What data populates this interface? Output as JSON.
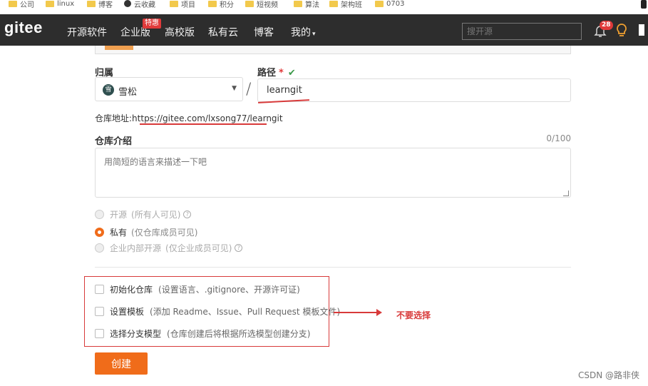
{
  "bookmarks": [
    {
      "label": "公司",
      "icon": "folder-icon"
    },
    {
      "label": "linux",
      "icon": "folder-icon"
    },
    {
      "label": "博客",
      "icon": "folder-icon"
    },
    {
      "label": "云收藏",
      "icon": "globe-icon"
    },
    {
      "label": "项目",
      "icon": "folder-icon"
    },
    {
      "label": "积分",
      "icon": "folder-icon"
    },
    {
      "label": "短视频",
      "icon": "folder-icon"
    },
    {
      "label": "算法",
      "icon": "folder-icon"
    },
    {
      "label": "架构班",
      "icon": "folder-icon"
    },
    {
      "label": "0703",
      "icon": "folder-icon"
    }
  ],
  "navbar": {
    "logo": "gitee",
    "items": [
      "开源软件",
      "企业版",
      "高校版",
      "私有云",
      "博客",
      "我的"
    ],
    "enterprise_badge": "特惠",
    "my_caret": "▾",
    "search_placeholder": "搜开源",
    "notification_count": "28"
  },
  "form": {
    "owner_label": "归属",
    "owner_avatar": "雪",
    "owner_value": "雪松",
    "slash": "/",
    "path_label": "路径",
    "path_required": "*",
    "path_valid": "✔",
    "path_value": "learngit",
    "address_label": "仓库地址:",
    "address_url": "https://gitee.com/lxsong77/learngit",
    "desc_label": "仓库介绍",
    "desc_counter": "0/100",
    "desc_placeholder": "用简短的语言来描述一下吧",
    "visibility": [
      {
        "label": "开源",
        "sub": "(所有人可见)",
        "help": "?",
        "state": "disabled",
        "checked": false
      },
      {
        "label": "私有",
        "sub": "(仅仓库成员可见)",
        "help": "",
        "state": "enabled",
        "checked": true
      },
      {
        "label": "企业内部开源",
        "sub": "(仅企业成员可见)",
        "help": "?",
        "state": "disabled",
        "checked": false
      }
    ],
    "options": [
      {
        "label": "初始化仓库",
        "sub": "(设置语言、.gitignore、开源许可证)",
        "checked": false
      },
      {
        "label": "设置模板",
        "sub": "(添加 Readme、Issue、Pull Request 模板文件)",
        "checked": false
      },
      {
        "label": "选择分支模型",
        "sub": "(仓库创建后将根据所选模型创建分支)",
        "checked": false
      }
    ],
    "annotation": "不要选择",
    "create_label": "创建"
  },
  "watermark": "CSDN @路非侠",
  "colors": {
    "accent": "#f06c1a",
    "navbar": "#2d2d2d",
    "annotation": "#d83a3a",
    "valid": "#3c9a4a"
  }
}
